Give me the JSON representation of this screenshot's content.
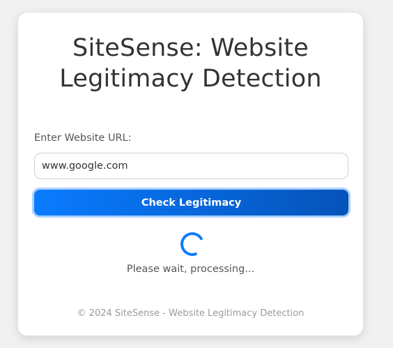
{
  "header": {
    "title": "SiteSense: Website Legitimacy Detection"
  },
  "form": {
    "label": "Enter Website URL:",
    "url_value": "www.google.com",
    "button_label": "Check Legitimacy"
  },
  "status": {
    "text": "Please wait, processing...",
    "spinner_icon": "loading-spinner-icon"
  },
  "footer": {
    "text": "© 2024 SiteSense - Website Legitimacy Detection"
  },
  "colors": {
    "accent": "#0b7cff",
    "accent_dark": "#0553b9",
    "title": "#333333",
    "muted": "#9a9a9a"
  }
}
